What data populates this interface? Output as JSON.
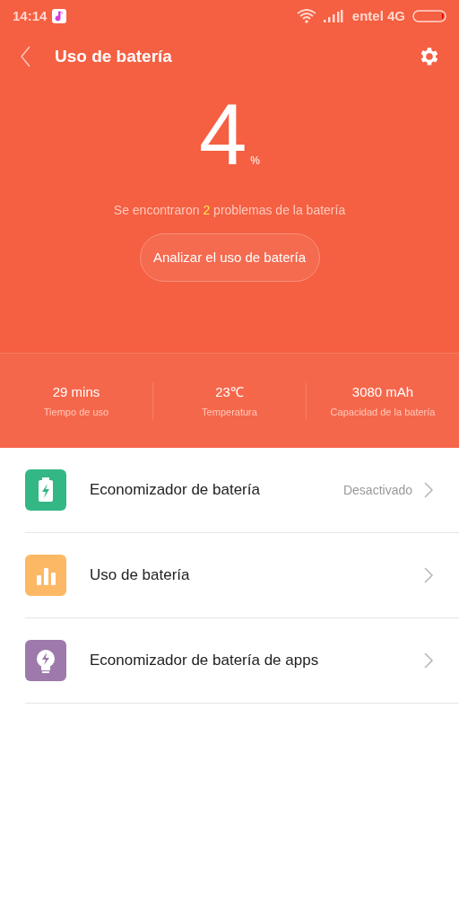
{
  "status_bar": {
    "time": "14:14",
    "carrier": "entel 4G"
  },
  "header": {
    "title": "Uso de batería"
  },
  "battery": {
    "percent": "4",
    "unit": "%",
    "problems": {
      "before": "Se encontraron",
      "count": "2",
      "after": "problemas de la batería"
    },
    "button": "Analizar el uso de batería"
  },
  "stats": [
    {
      "value": "29 mins",
      "label": "Tiempo de uso"
    },
    {
      "value": "23℃",
      "label": "Temperatura"
    },
    {
      "value": "3080 mAh",
      "label": "Capacidad de la batería"
    }
  ],
  "items": [
    {
      "kind": "battery",
      "color": "#33b784",
      "title": "Economizador de batería",
      "status": "Desactivado"
    },
    {
      "kind": "chart",
      "color": "#fdb866",
      "title": "Uso de batería"
    },
    {
      "kind": "bulb",
      "color": "#9d7aab",
      "title": "Economizador de batería de apps"
    }
  ]
}
